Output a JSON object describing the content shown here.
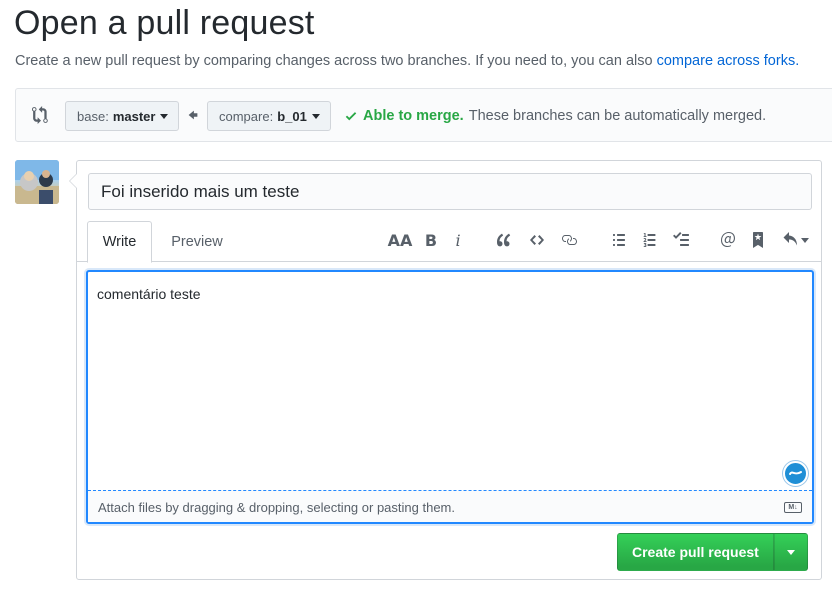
{
  "page_title": "Open a pull request",
  "subtitle": {
    "text": "Create a new pull request by comparing changes across two branches. If you need to, you can also ",
    "link": "compare across forks."
  },
  "range": {
    "base_label": "base:",
    "base_value": "master",
    "compare_label": "compare:",
    "compare_value": "b_01",
    "merge_ok": "Able to merge.",
    "merge_text": "These branches can be automatically merged."
  },
  "composer": {
    "title_value": "Foi inserido mais um teste",
    "tabs": {
      "write": "Write",
      "preview": "Preview"
    },
    "toolbar": {
      "heading": "AA",
      "bold": "B",
      "italic": "i"
    },
    "body_value": "comentário teste",
    "attach_hint": "Attach files by dragging & dropping, selecting or pasting them.",
    "markdown_badge": "M↓",
    "create_button": "Create pull request"
  },
  "colors": {
    "green": "#28a745",
    "link": "#0366d6",
    "focus": "#2188ff"
  },
  "icons": [
    "git-compare-icon",
    "arrow-left-icon",
    "check-icon",
    "quote-icon",
    "code-icon",
    "link-icon",
    "unordered-list-icon",
    "ordered-list-icon",
    "task-list-icon",
    "mention-icon",
    "bookmark-icon",
    "reply-icon",
    "grammarly-icon",
    "markdown-icon"
  ]
}
